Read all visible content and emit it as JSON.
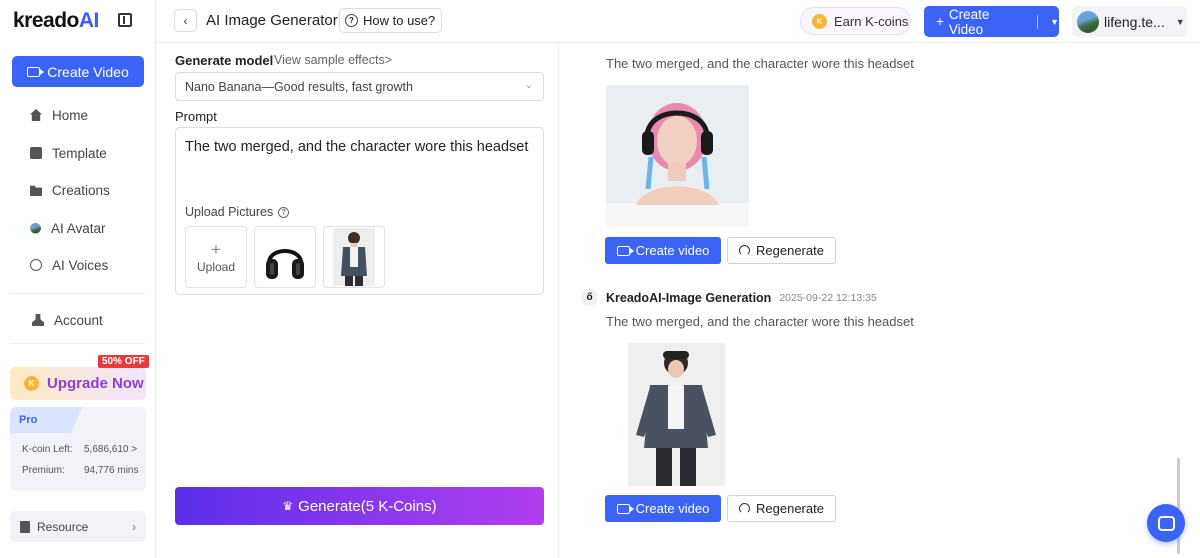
{
  "brand": {
    "logo_main": "kreado",
    "logo_ai": "AI"
  },
  "sidebar": {
    "create_label": "Create Video",
    "items": [
      {
        "label": "Home",
        "icon": "home-icon"
      },
      {
        "label": "Template",
        "icon": "template-icon"
      },
      {
        "label": "Creations",
        "icon": "folder-icon"
      },
      {
        "label": "AI Avatar",
        "icon": "avatar-icon"
      },
      {
        "label": "AI Voices",
        "icon": "voice-icon"
      }
    ],
    "account_label": "Account",
    "upgrade": {
      "label": "Upgrade Now",
      "badge": "50% OFF"
    },
    "pro": {
      "tag": "Pro",
      "kcoin_label": "K-coin Left:",
      "kcoin_value": "5,686,610 >",
      "premium_label": "Premium:",
      "premium_value": "94,776 mins"
    },
    "resource_label": "Resource"
  },
  "header": {
    "title": "AI Image Generator",
    "how_to": "How to use?",
    "earn": "Earn K-coins",
    "create": "Create Video",
    "user": "lifeng.te..."
  },
  "form": {
    "model_label": "Generate model",
    "sample_link": "View sample effects>",
    "model_value": "Nano Banana—Good results, fast growth",
    "prompt_label": "Prompt",
    "prompt_text": "The two merged, and the character wore this headset",
    "upload_label": "Upload Pictures",
    "upload_tile": "Upload",
    "generate": "Generate(5 K-Coins)"
  },
  "results": [
    {
      "text": "The two merged, and the character wore this headset",
      "create": "Create video",
      "regen": "Regenerate"
    },
    {
      "author": "KreadoAI-Image Generation",
      "time": "2025-09-22 12:13:35",
      "text": "The two merged, and the character wore this headset",
      "create": "Create video",
      "regen": "Regenerate"
    }
  ]
}
